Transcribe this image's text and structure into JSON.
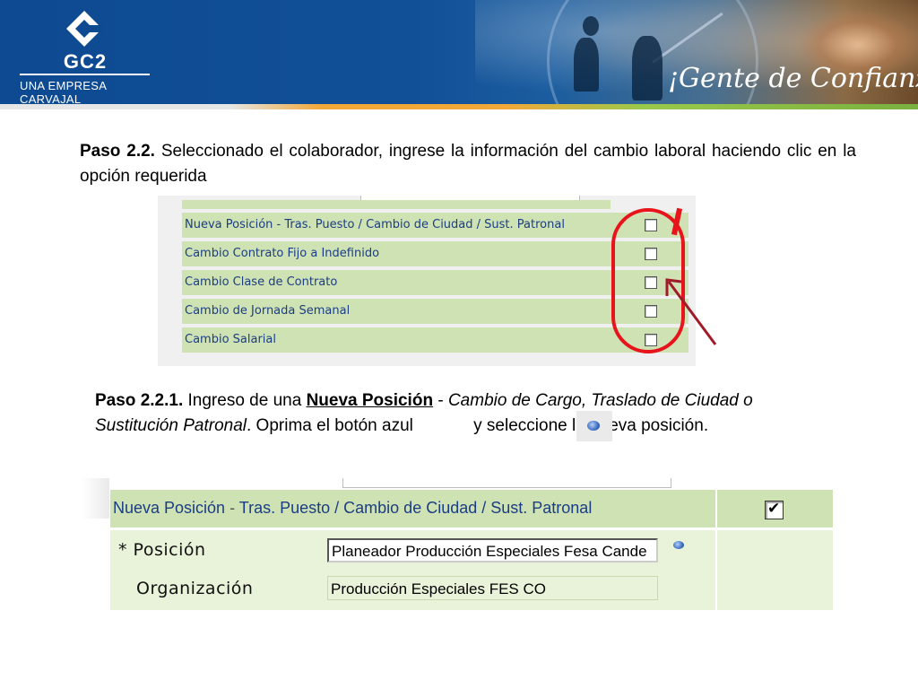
{
  "header": {
    "logo_text": "GC2",
    "logo_subtitle": "UNA EMPRESA CARVAJAL",
    "slogan": "¡Gente de Confianza!"
  },
  "step1": {
    "label": "Paso 2.2.",
    "text": "Seleccionado el colaborador, ingrese la información del cambio laboral haciendo clic en la opción requerida"
  },
  "options": [
    {
      "label": "Nueva Posición - Tras. Puesto / Cambio de Ciudad / Sust. Patronal",
      "checked": false
    },
    {
      "label": "Cambio Contrato Fijo a Indefinido",
      "checked": false
    },
    {
      "label": "Cambio Clase de Contrato",
      "checked": false
    },
    {
      "label": "Cambio de Jornada Semanal",
      "checked": false
    },
    {
      "label": "Cambio Salarial",
      "checked": false
    }
  ],
  "step2": {
    "label": "Paso 2.2.1.",
    "text_a": "Ingreso de una",
    "underlined": "Nueva Posición",
    "dash": "-",
    "italic": "Cambio de Cargo, Traslado de Ciudad o Sustitución Patronal",
    "text_b": ". Oprima el botón azul",
    "text_c": "y seleccione la nueva posición."
  },
  "form": {
    "header_left": "Nueva Posición",
    "header_dash": "-",
    "header_right": "Tras. Puesto / Cambio de Ciudad / Sust. Patronal",
    "checked": true,
    "position_label": "* Posición",
    "position_value": "Planeador Producción Especiales Fesa Cande",
    "organization_label": "Organización",
    "organization_value": "Producción Especiales FES CO"
  },
  "colors": {
    "header_blue": "#0d4a92",
    "row_green": "#cfe2b4",
    "row_text_blue": "#1b3d84",
    "annotation_red": "#e8141b",
    "arrow_maroon": "#a11a2a"
  },
  "icons": [
    "gc2-logo-icon",
    "checkbox-icon",
    "lov-search-icon",
    "annotation-arrow-icon"
  ]
}
